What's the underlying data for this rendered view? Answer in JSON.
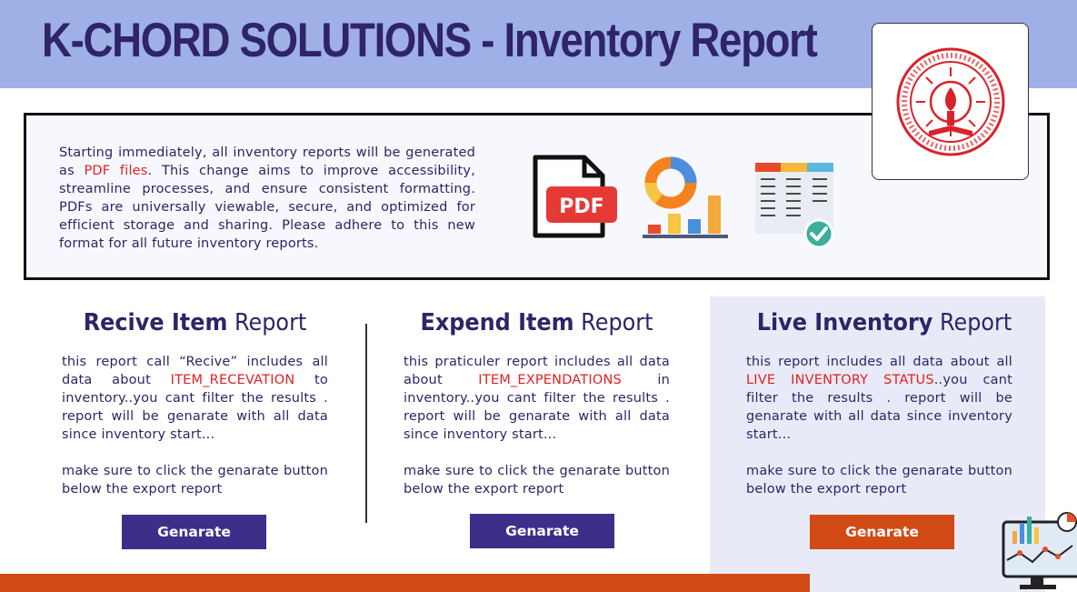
{
  "header": {
    "title": "K-CHORD SOLUTIONS - Inventory Report"
  },
  "notice": {
    "text_before": "Starting immediately, all inventory reports will be generated as ",
    "highlight": "PDF files",
    "text_after": ". This change aims to improve accessibility, streamline processes, and ensure consistent formatting. PDFs are universally viewable, secure, and optimized for efficient storage and sharing. Please adhere to this new format for all future inventory reports.",
    "pdf_icon_label": "PDF"
  },
  "cards": [
    {
      "title_bold": "Recive Item",
      "title_rest": " Report",
      "desc_before": "this report call “Recive” includes all data about ",
      "desc_highlight": "ITEM_RECEVATION",
      "desc_after": " to inventory..you cant filter the results . report will be genarate with all data since inventory start...",
      "note": "make sure to click the genarate button below the export report",
      "button": "Genarate"
    },
    {
      "title_bold": "Expend Item",
      "title_rest": " Report",
      "desc_before": "this praticuler report includes all data about ",
      "desc_highlight": "ITEM_EXPENDATIONS",
      "desc_after": " in inventory..you cant filter the results . report will be genarate with all data since inventory start...",
      "note": "make sure to click the genarate button below the export report",
      "button": "Genarate"
    },
    {
      "title_bold": "Live Inventory",
      "title_rest": " Report",
      "desc_before": "this report includes all data about all ",
      "desc_highlight": "LIVE INVENTORY STATUS",
      "desc_after": "..you cant filter the results . report will be genarate with all data since inventory start...",
      "note": "make sure to click the genarate button below the export report",
      "button": "Genarate"
    }
  ],
  "colors": {
    "header_bg": "#9fb0e6",
    "title": "#2e2467",
    "accent_red": "#e32020",
    "button_blue": "#3b2f8a",
    "button_orange": "#d24a14",
    "live_panel_bg": "#e8ebf7"
  },
  "icons": [
    "logo-emblem",
    "pdf-file-icon",
    "charts-icon",
    "spreadsheet-check-icon",
    "monitor-analytics-icon"
  ]
}
